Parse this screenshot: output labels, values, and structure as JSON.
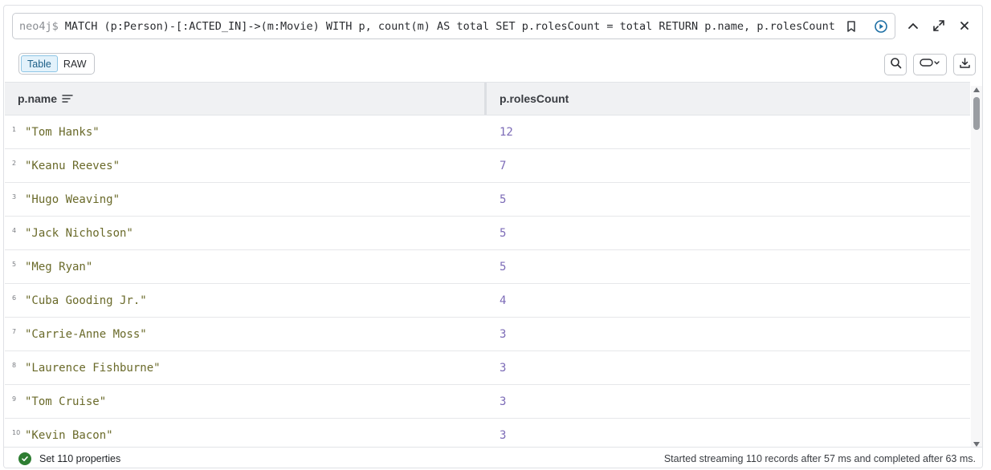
{
  "query": {
    "prompt": "neo4j$",
    "text": "MATCH (p:Person)-[:ACTED_IN]->(m:Movie) WITH p, count(m) AS total SET p.rolesCount = total RETURN p.name, p.rolesCount ORDER BY p.rolesCount DESC"
  },
  "toolbar": {
    "table_label": "Table",
    "raw_label": "RAW"
  },
  "table": {
    "columns": [
      "p.name",
      "p.rolesCount"
    ],
    "rows": [
      {
        "n": "1",
        "name": "\"Tom Hanks\"",
        "count": "12"
      },
      {
        "n": "2",
        "name": "\"Keanu Reeves\"",
        "count": "7"
      },
      {
        "n": "3",
        "name": "\"Hugo Weaving\"",
        "count": "5"
      },
      {
        "n": "4",
        "name": "\"Jack Nicholson\"",
        "count": "5"
      },
      {
        "n": "5",
        "name": "\"Meg Ryan\"",
        "count": "5"
      },
      {
        "n": "6",
        "name": "\"Cuba Gooding Jr.\"",
        "count": "4"
      },
      {
        "n": "7",
        "name": "\"Carrie-Anne Moss\"",
        "count": "3"
      },
      {
        "n": "8",
        "name": "\"Laurence Fishburne\"",
        "count": "3"
      },
      {
        "n": "9",
        "name": "\"Tom Cruise\"",
        "count": "3"
      },
      {
        "n": "10",
        "name": "\"Kevin Bacon\"",
        "count": "3"
      }
    ]
  },
  "footer": {
    "status": "Set 110 properties",
    "summary": "Started streaming 110 records after 57 ms and completed after 63 ms."
  },
  "icons": {
    "bookmark": "bookmark-icon",
    "run": "play-circle-icon",
    "collapse": "chevron-up-icon",
    "expand": "expand-icon",
    "close": "close-icon",
    "search": "search-icon",
    "shape": "pill-dropdown-icon",
    "download": "download-icon",
    "status": "check-circle-icon",
    "sort": "sort-lines-icon"
  },
  "colors": {
    "string": "#6a6a2a",
    "number": "#7c6bb7",
    "success": "#2e7d32",
    "active_tab": "#e3f2fb"
  }
}
